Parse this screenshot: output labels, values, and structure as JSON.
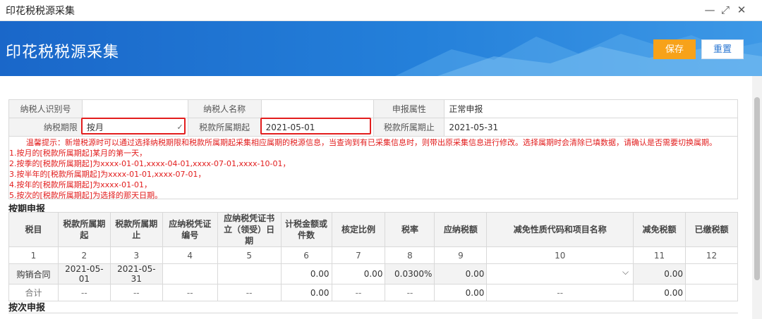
{
  "window": {
    "title": "印花税税源采集",
    "minimize": "—",
    "maximize": "⤢",
    "close": "✕"
  },
  "banner": {
    "title": "印花税税源采集",
    "save_label": "保存",
    "reset_label": "重置"
  },
  "info": {
    "taxpayer_id_label": "纳税人识别号",
    "taxpayer_id_value": "",
    "taxpayer_name_label": "纳税人名称",
    "taxpayer_name_value": "",
    "declare_attr_label": "申报属性",
    "declare_attr_value": "正常申报",
    "period_label": "纳税期限",
    "period_value": "按月",
    "start_label": "税款所属期起",
    "start_value": "2021-05-01",
    "end_label": "税款所属期止",
    "end_value": "2021-05-31"
  },
  "tips": [
    "温馨提示：新增税源时可以通过选择纳税期限和税款所属期起采集相应属期的税源信息，当查询到有已采集信息时，则带出原采集信息进行修改。选择属期时会清除已填数据，请确认是否需要切换属期。",
    "1.按月的[税款所属期起]某月的第一天，",
    "2.按季的[税款所属期起]为xxxx-01-01,xxxx-04-01,xxxx-07-01,xxxx-10-01，",
    "3.按半年的[税款所属期起]为xxxx-01-01,xxxx-07-01，",
    "4.按年的[税款所属期起]为xxxx-01-01，",
    "5.按次的[税款所属期起]为选择的那天日期。"
  ],
  "section1": "按期申报",
  "section2": "按次申报",
  "grid": {
    "headers": [
      "税目",
      "税款所属期起",
      "税款所属期止",
      "应纳税凭证编号",
      "应纳税凭证书立（领受）日期",
      "计税金额或件数",
      "核定比例",
      "税率",
      "应纳税额",
      "减免性质代码和项目名称",
      "减免税额",
      "已缴税额"
    ],
    "numbers": [
      "1",
      "2",
      "3",
      "4",
      "5",
      "6",
      "7",
      "8",
      "9",
      "10",
      "11",
      "12"
    ],
    "row": {
      "item": "购销合同",
      "start": "2021-05-01",
      "end": "2021-05-31",
      "voucher_no": "",
      "date": "",
      "amount": "0.00",
      "ratio": "0.00",
      "rate": "0.0300%",
      "tax": "0.00",
      "relief_code": "",
      "relief_amount": "0.00",
      "paid": ""
    },
    "total": {
      "label": "合计",
      "c2": "--",
      "c3": "--",
      "c4": "--",
      "c5": "--",
      "amount": "0.00",
      "ratio": "--",
      "rate": "--",
      "tax": "0.00",
      "relief_code": "--",
      "relief_amount": "0.00",
      "paid": ""
    }
  },
  "colors": {
    "banner": "#2480da",
    "save": "#f7a21a",
    "tips": "#e21d1d",
    "highlight": "#e21d1d"
  }
}
